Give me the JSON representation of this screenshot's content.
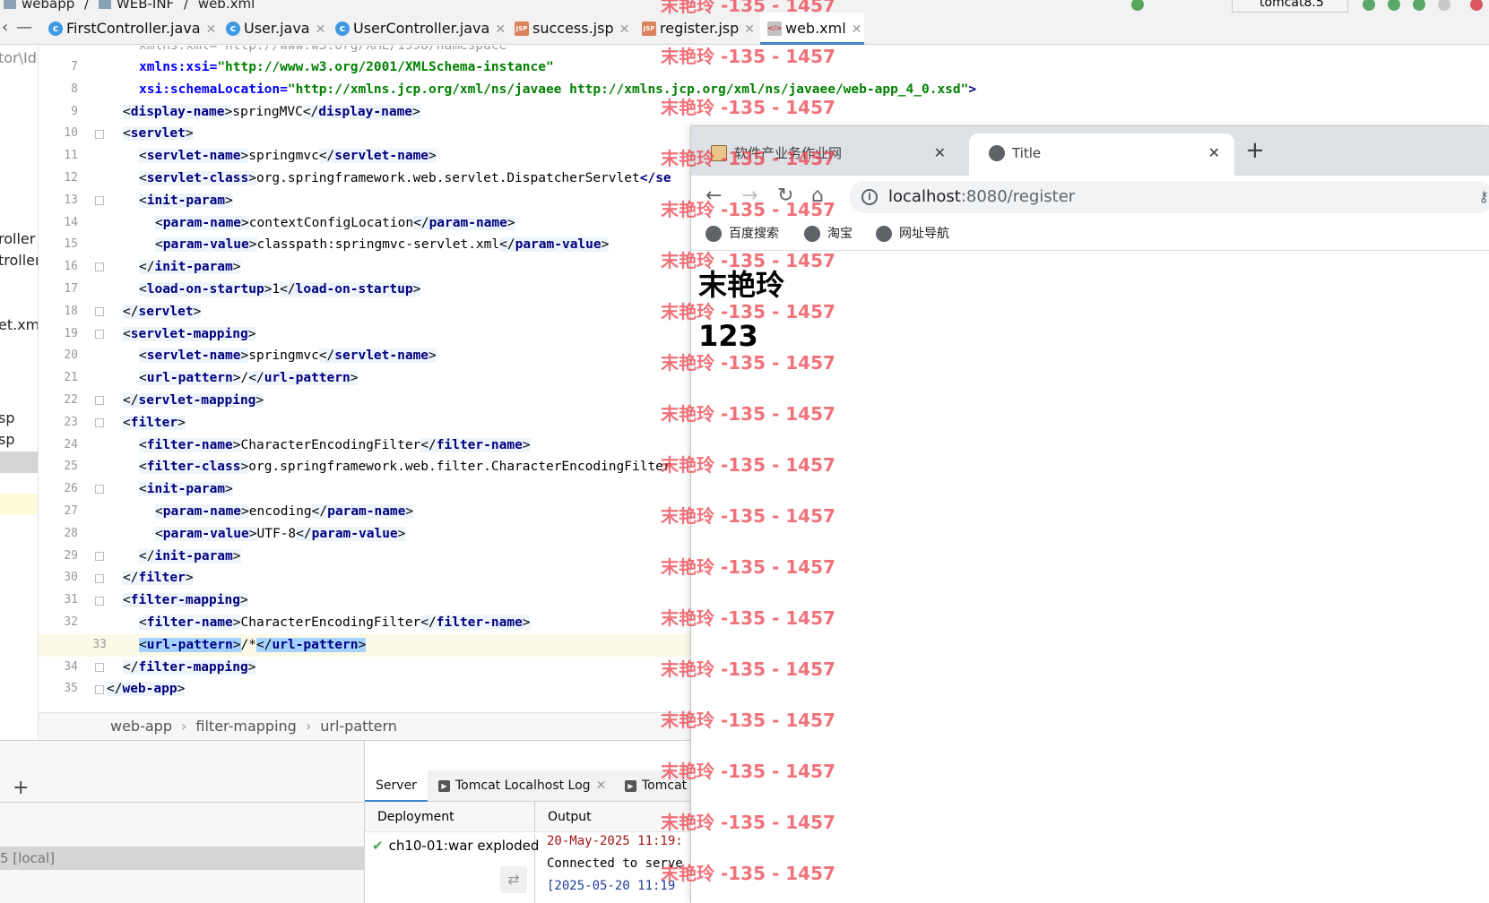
{
  "ide": {
    "breadcrumb": [
      "webapp",
      "WEB-INF",
      "web.xml"
    ],
    "run_config": "tomcat8.5",
    "tabs": [
      {
        "label": "FirstController.java",
        "icon": "class-icon",
        "active": false
      },
      {
        "label": "User.java",
        "icon": "class-icon",
        "active": false
      },
      {
        "label": "UserController.java",
        "icon": "class-icon",
        "active": false
      },
      {
        "label": "success.jsp",
        "icon": "jsp-file-icon",
        "active": false
      },
      {
        "label": "register.jsp",
        "icon": "jsp-file-icon",
        "active": false
      },
      {
        "label": "web.xml",
        "icon": "xml-file-icon",
        "active": true
      }
    ],
    "project_items": [
      "tor\\Ide",
      "roller",
      "troller",
      "et.xml",
      "sp",
      "sp"
    ],
    "line_numbers": [
      "7",
      "8",
      "9",
      "10",
      "11",
      "12",
      "13",
      "14",
      "15",
      "16",
      "17",
      "18",
      "19",
      "20",
      "21",
      "22",
      "23",
      "24",
      "25",
      "26",
      "27",
      "28",
      "29",
      "30",
      "31",
      "32",
      "33",
      "34",
      "35"
    ],
    "code": {
      "l6_partial": "xmlns:xml=\"http://www.w3.org/XML/1998/namespace\"",
      "l7_attr": "xmlns:xsi",
      "l7_val": "\"http://www.w3.org/2001/XMLSchema-instance\"",
      "l8_attr": "xsi:schemaLocation",
      "l8_val": "\"http://xmlns.jcp.org/xml/ns/javaee http://xmlns.jcp.org/xml/ns/javaee/web-app_4_0.xsd\"",
      "display_name_tag": "display-name",
      "display_name_val": "springMVC",
      "servlet": "servlet",
      "servlet_name": "servlet-name",
      "servlet_name_val": "springmvc",
      "servlet_class": "servlet-class",
      "servlet_class_val": "org.springframework.web.servlet.DispatcherServlet",
      "servlet_class_close_partial": "</se",
      "init_param": "init-param",
      "param_name": "param-name",
      "param_name_val1": "contextConfigLocation",
      "param_value": "param-value",
      "param_value_val1": "classpath:springmvc-servlet.xml",
      "load_on_startup": "load-on-startup",
      "load_on_startup_val": "1",
      "servlet_mapping": "servlet-mapping",
      "url_pattern": "url-pattern",
      "url_pattern_val1": "/",
      "filter": "filter",
      "filter_name": "filter-name",
      "filter_name_val": "CharacterEncodingFilter",
      "filter_class": "filter-class",
      "filter_class_val": "org.springframework.web.filter.CharacterEncodingFilter",
      "param_name_val2": "encoding",
      "param_value_val2": "UTF-8",
      "filter_mapping": "filter-mapping",
      "url_pattern_val2": "/*",
      "web_app": "web-app"
    },
    "editor_breadcrumb": [
      "web-app",
      "filter-mapping",
      "url-pattern"
    ],
    "services": {
      "add_label": "+",
      "tree_selected": "5 [local]",
      "tabs": [
        "Server",
        "Tomcat Localhost Log",
        "Tomcat"
      ],
      "deployment_header": "Deployment",
      "output_header": "Output",
      "deployment_item": "ch10-01:war exploded",
      "output_lines": [
        "20-May-2025 11:19:",
        "Connected to serve",
        "[2025-05-20 11:19"
      ]
    }
  },
  "browser": {
    "tabs": [
      {
        "title": "软件产业务作业网",
        "active": false
      },
      {
        "title": "Title",
        "active": true
      }
    ],
    "url_host": "localhost",
    "url_path": ":8080/register",
    "bookmarks": [
      "百度搜索",
      "淘宝",
      "网址导航"
    ],
    "page": {
      "heading1": "末艳玲",
      "heading2": "123"
    }
  },
  "watermark": {
    "text": "末艳玲 -135 - 1457",
    "color": "#eb3c46"
  }
}
